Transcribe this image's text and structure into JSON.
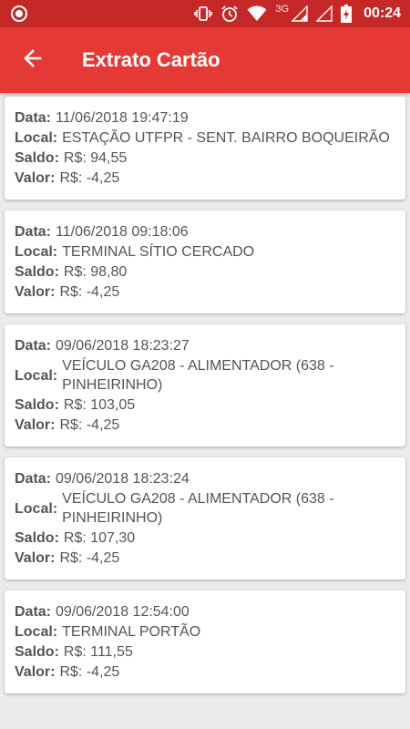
{
  "status_bar": {
    "network_label": "3G",
    "time": "00:24",
    "icons": [
      "app-notification-icon",
      "vibrate-icon",
      "alarm-icon",
      "wifi-icon",
      "signal-icon",
      "signal-icon",
      "battery-charging-icon"
    ]
  },
  "app_bar": {
    "title": "Extrato Cartão",
    "back_icon": "arrow-back-icon"
  },
  "labels": {
    "data": "Data:",
    "local": "Local:",
    "saldo": "Saldo:",
    "valor": "Valor:"
  },
  "transactions": [
    {
      "data": "11/06/2018 19:47:19",
      "local": "ESTAÇÃO UTFPR - SENT. BAIRRO BOQUEIRÃO",
      "saldo": "R$: 94,55",
      "valor": "R$: -4,25"
    },
    {
      "data": "11/06/2018 09:18:06",
      "local": "TERMINAL SÍTIO CERCADO",
      "saldo": "R$: 98,80",
      "valor": "R$: -4,25"
    },
    {
      "data": "09/06/2018 18:23:27",
      "local": "VEÍCULO GA208 - ALIMENTADOR (638 - PINHEIRINHO)",
      "saldo": "R$: 103,05",
      "valor": "R$: -4,25"
    },
    {
      "data": "09/06/2018 18:23:24",
      "local": "VEÍCULO GA208 - ALIMENTADOR (638 - PINHEIRINHO)",
      "saldo": "R$: 107,30",
      "valor": "R$: -4,25"
    },
    {
      "data": "09/06/2018 12:54:00",
      "local": "TERMINAL PORTÃO",
      "saldo": "R$: 111,55",
      "valor": "R$: -4,25"
    }
  ],
  "colors": {
    "status_bar": "#c62828",
    "app_bar": "#e53935",
    "background": "#ebebeb",
    "card": "#ffffff",
    "text": "#555555"
  }
}
